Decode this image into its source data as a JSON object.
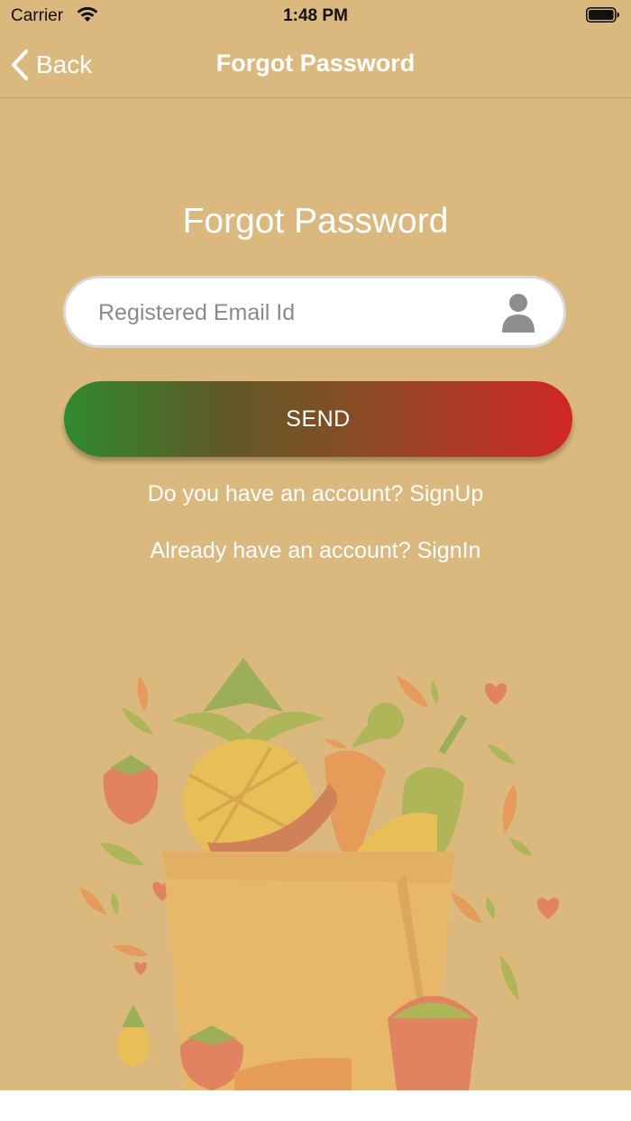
{
  "status_bar": {
    "carrier": "Carrier",
    "time": "1:48 PM"
  },
  "nav": {
    "back_label": "Back",
    "title": "Forgot Password"
  },
  "main": {
    "title": "Forgot Password",
    "email_placeholder": "Registered Email Id",
    "email_value": "",
    "send_label": "SEND",
    "signup_prompt": "Do you have an account? SignUp",
    "signin_prompt": "Already have an account? SignIn"
  },
  "colors": {
    "background": "#dbb97e",
    "gradient_start": "#2f8b2e",
    "gradient_end": "#d02626"
  },
  "icons": {
    "back": "chevron-left-icon",
    "user": "user-icon",
    "wifi": "wifi-icon",
    "battery": "battery-icon"
  }
}
